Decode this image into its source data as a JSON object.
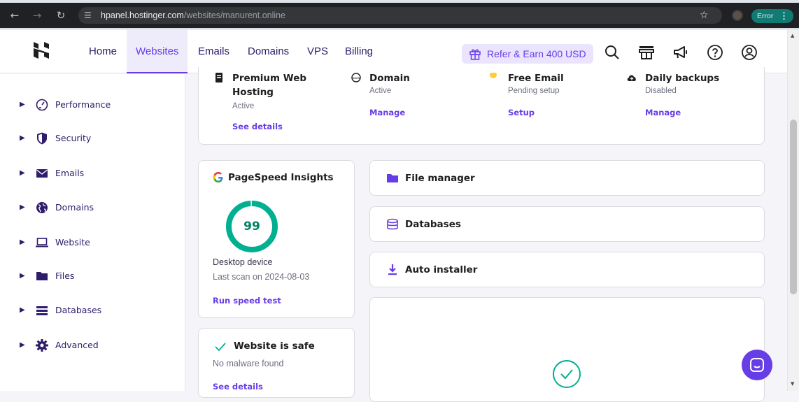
{
  "browser": {
    "url_host": "hpanel.hostinger.com",
    "url_path": "/websites/manurent.online",
    "error_label": "Error"
  },
  "header": {
    "nav": [
      "Home",
      "Websites",
      "Emails",
      "Domains",
      "VPS",
      "Billing"
    ],
    "active_nav": "Websites",
    "refer_label": "Refer & Earn 400 USD"
  },
  "sidebar": {
    "items": [
      {
        "label": "Performance",
        "icon": "performance-icon"
      },
      {
        "label": "Security",
        "icon": "shield-icon"
      },
      {
        "label": "Emails",
        "icon": "mail-icon"
      },
      {
        "label": "Domains",
        "icon": "globe-icon"
      },
      {
        "label": "Website",
        "icon": "laptop-icon"
      },
      {
        "label": "Files",
        "icon": "folder-icon"
      },
      {
        "label": "Databases",
        "icon": "database-list-icon"
      },
      {
        "label": "Advanced",
        "icon": "gear-icon"
      }
    ]
  },
  "plan": {
    "features": [
      {
        "title_line1": "Premium Web",
        "title_line2": "Hosting",
        "status": "Active",
        "link": "See details"
      },
      {
        "title_line1": "Domain",
        "title_line2": "",
        "status": "Active",
        "link": "Manage"
      },
      {
        "title_line1": "Free Email",
        "title_line2": "",
        "status": "Pending setup",
        "link": "Setup"
      },
      {
        "title_line1": "Daily backups",
        "title_line2": "",
        "status": "Disabled",
        "link": "Manage"
      }
    ]
  },
  "pagespeed": {
    "title": "PageSpeed Insights",
    "score": "99",
    "score_fraction": 0.99,
    "device": "Desktop device",
    "last_scan": "Last scan on 2024-08-03",
    "action": "Run speed test"
  },
  "security": {
    "title": "Website is safe",
    "subtitle": "No malware found",
    "link": "See details"
  },
  "tools": [
    {
      "label": "File manager",
      "icon": "folder-icon"
    },
    {
      "label": "Databases",
      "icon": "database-icon"
    },
    {
      "label": "Auto installer",
      "icon": "download-icon"
    }
  ],
  "colors": {
    "brand": "#673de6",
    "success": "#00b090",
    "warning": "#ffcd35"
  }
}
